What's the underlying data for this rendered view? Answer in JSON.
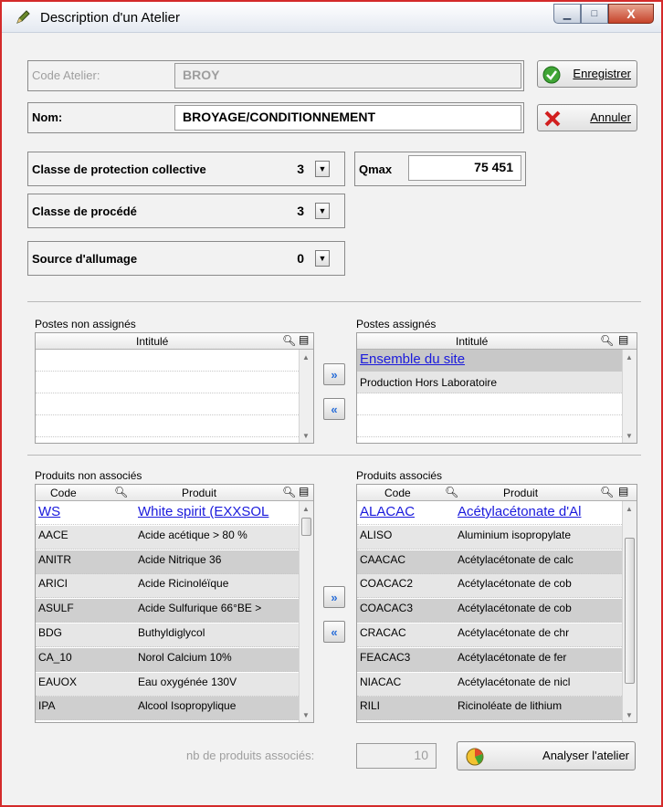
{
  "window": {
    "title": "Description d'un Atelier",
    "minimize_glyph": "▁",
    "maximize_glyph": "□",
    "close_glyph": "X"
  },
  "form": {
    "code_label": "Code Atelier:",
    "code_value": "BROY",
    "nom_label": "Nom:",
    "nom_value": "BROYAGE/CONDITIONNEMENT",
    "enregistrer_label": "Enregistrer",
    "annuler_label": "Annuler",
    "classe_protection_label": "Classe de protection collective",
    "classe_protection_value": "3",
    "qmax_label": "Qmax",
    "qmax_value": "75 451",
    "classe_procede_label": "Classe de procédé",
    "classe_procede_value": "3",
    "source_allumage_label": "Source d'allumage",
    "source_allumage_value": "0"
  },
  "postes_non_assignes": {
    "label": "Postes non assignés",
    "column": "Intitulé",
    "rows": []
  },
  "postes_assignes": {
    "label": "Postes assignés",
    "column": "Intitulé",
    "rows": [
      "Ensemble du site",
      "Production Hors Laboratoire"
    ]
  },
  "produits_non_associes": {
    "label": "Produits non associés",
    "col_code": "Code",
    "col_produit": "Produit",
    "rows": [
      {
        "code": "WS",
        "produit": "White spirit (EXXSOL"
      },
      {
        "code": "AACE",
        "produit": "Acide acétique > 80 %"
      },
      {
        "code": "ANITR",
        "produit": "Acide Nitrique 36"
      },
      {
        "code": "ARICI",
        "produit": "Acide Ricinoléïque"
      },
      {
        "code": "ASULF",
        "produit": "Acide Sulfurique 66°BE >"
      },
      {
        "code": "BDG",
        "produit": "Buthyldiglycol"
      },
      {
        "code": "CA_10",
        "produit": "Norol Calcium 10%"
      },
      {
        "code": "EAUOX",
        "produit": "Eau oxygénée 130V"
      },
      {
        "code": "IPA",
        "produit": "Alcool Isopropylique"
      }
    ]
  },
  "produits_associes": {
    "label": "Produits associés",
    "col_code": "Code",
    "col_produit": "Produit",
    "rows": [
      {
        "code": "ALACAC",
        "produit": "Acétylacétonate d'Al"
      },
      {
        "code": "ALISO",
        "produit": "Aluminium isopropylate"
      },
      {
        "code": "CAACAC",
        "produit": "Acétylacétonate de calc"
      },
      {
        "code": "COACAC2",
        "produit": "Acétylacétonate de cob"
      },
      {
        "code": "COACAC3",
        "produit": "Acétylacétonate de cob"
      },
      {
        "code": "CRACAC",
        "produit": "Acétylacétonate de chr"
      },
      {
        "code": "FEACAC3",
        "produit": "Acétylacétonate de fer"
      },
      {
        "code": "NIACAC",
        "produit": "Acétylacétonate de nicl"
      },
      {
        "code": "RILI",
        "produit": "Ricinoléate de lithium"
      }
    ]
  },
  "footer": {
    "nb_label": "nb de produits associés:",
    "nb_value": "10",
    "analyser_label": "Analyser l'atelier"
  },
  "icons": {
    "app": "pencil-icon",
    "save": "green-check-icon",
    "cancel": "red-x-icon",
    "search": "magnifier-icon",
    "columns": "column-config-icon",
    "move_right": "double-arrow-right-icon",
    "move_left": "double-arrow-left-icon",
    "analyze": "analysis-icon"
  },
  "colors": {
    "window_border": "#d42a2a",
    "link": "#1a1adc",
    "selected_row": "#c8c8c8",
    "arrow_blue": "#2b6fd8"
  }
}
